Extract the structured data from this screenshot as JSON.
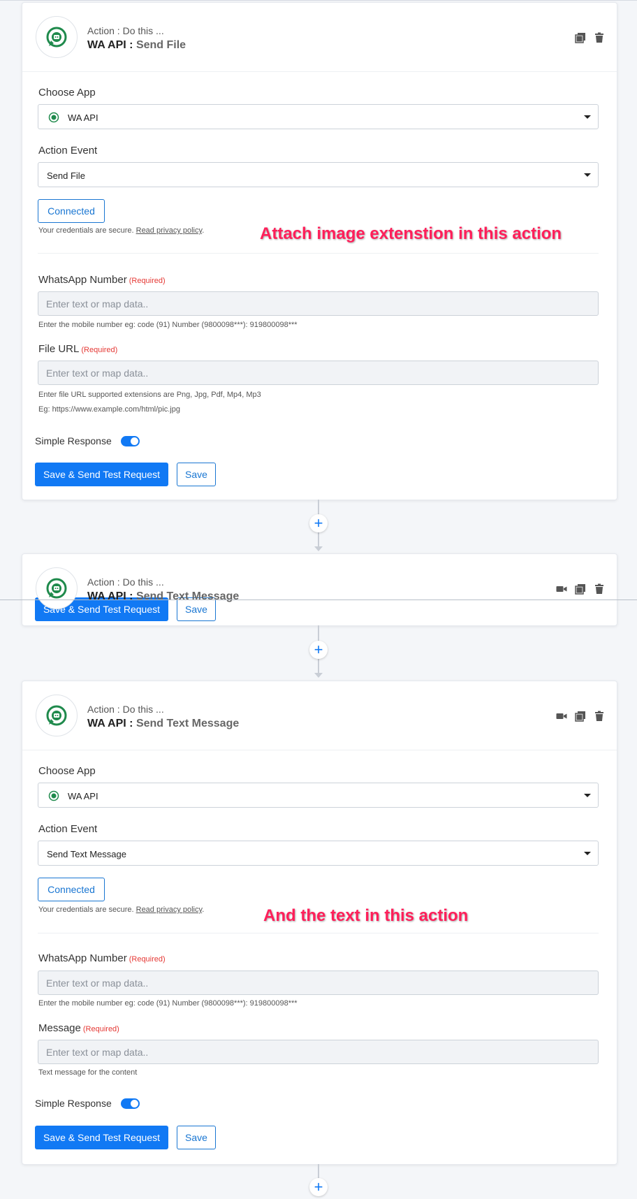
{
  "colors": {
    "accent": "#1179f4",
    "annotation": "#ff1f5a",
    "required": "#e53935",
    "wa_green": "#1f8a4c"
  },
  "icons": {
    "app_logo": "whatsapp-bot-icon",
    "copy": "copy-icon",
    "delete": "trash-icon",
    "video": "video-icon",
    "add": "plus-icon"
  },
  "card1": {
    "sub": "Action : Do this ...",
    "app": "WA API :",
    "event": "Send File",
    "choose_app_label": "Choose App",
    "choose_app_value": "WA API",
    "action_event_label": "Action Event",
    "action_event_value": "Send File",
    "connected": "Connected",
    "secure_text": "Your credentials are secure.",
    "privacy_link": "Read privacy policy",
    "privacy_dot": ".",
    "f1_label": "WhatsApp Number",
    "f1_req": "(Required)",
    "f1_placeholder": "Enter text or map data..",
    "f1_help": "Enter the mobile number eg: code (91) Number (9800098***): 919800098***",
    "f2_label": "File URL",
    "f2_req": "(Required)",
    "f2_placeholder": "Enter text or map data..",
    "f2_help1": "Enter file URL supported extensions are Png, Jpg, Pdf, Mp4, Mp3",
    "f2_help2": "Eg: https://www.example.com/html/pic.jpg",
    "simple_response": "Simple Response",
    "save_test": "Save & Send Test Request",
    "save": "Save"
  },
  "annotation1": "Attach image extenstion in this action",
  "card2": {
    "sub": "Action : Do this ...",
    "app": "WA API :",
    "event": "Send Text Message",
    "ghost_save_test": "Save & Send Test Request",
    "ghost_save": "Save"
  },
  "card3": {
    "sub": "Action : Do this ...",
    "app": "WA API :",
    "event": "Send Text Message",
    "choose_app_label": "Choose App",
    "choose_app_value": "WA API",
    "action_event_label": "Action Event",
    "action_event_value": "Send Text Message",
    "connected": "Connected",
    "secure_text": "Your credentials are secure.",
    "privacy_link": "Read privacy policy",
    "privacy_dot": ".",
    "f1_label": "WhatsApp Number",
    "f1_req": "(Required)",
    "f1_placeholder": "Enter text or map data..",
    "f1_help": "Enter the mobile number eg: code (91) Number (9800098***): 919800098***",
    "f2_label": "Message",
    "f2_req": "(Required)",
    "f2_placeholder": "Enter text or map data..",
    "f2_help": "Text message for the content",
    "simple_response": "Simple Response",
    "save_test": "Save & Send Test Request",
    "save": "Save"
  },
  "annotation2": "And the text in this action",
  "plus_symbol": "+"
}
